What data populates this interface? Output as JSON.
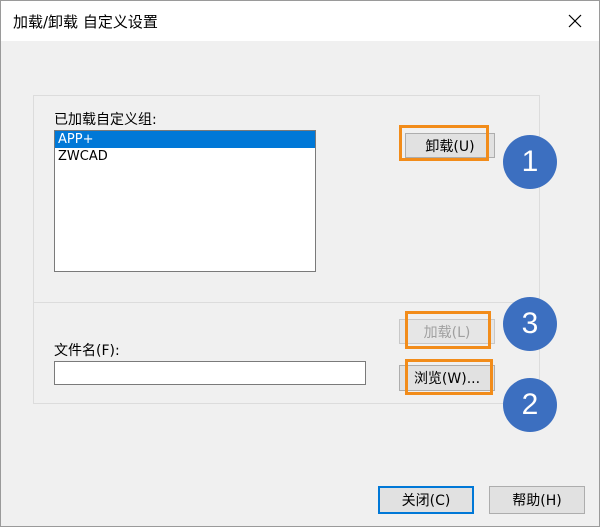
{
  "window": {
    "title": "加载/卸载 自定义设置"
  },
  "group": {
    "loaded_label": "已加载自定义组:",
    "items": [
      "APP+",
      "ZWCAD"
    ],
    "selected_index": 0
  },
  "buttons": {
    "unload": "卸载(U)",
    "load": "加载(L)",
    "browse": "浏览(W)...",
    "close": "关闭(C)",
    "help": "帮助(H)"
  },
  "file": {
    "label": "文件名(F):",
    "value": "",
    "placeholder": ""
  },
  "annotations": {
    "badge_1": "1",
    "badge_2": "2",
    "badge_3": "3",
    "highlight_color": "#f28c1a",
    "badge_color": "#3c6fc0"
  }
}
